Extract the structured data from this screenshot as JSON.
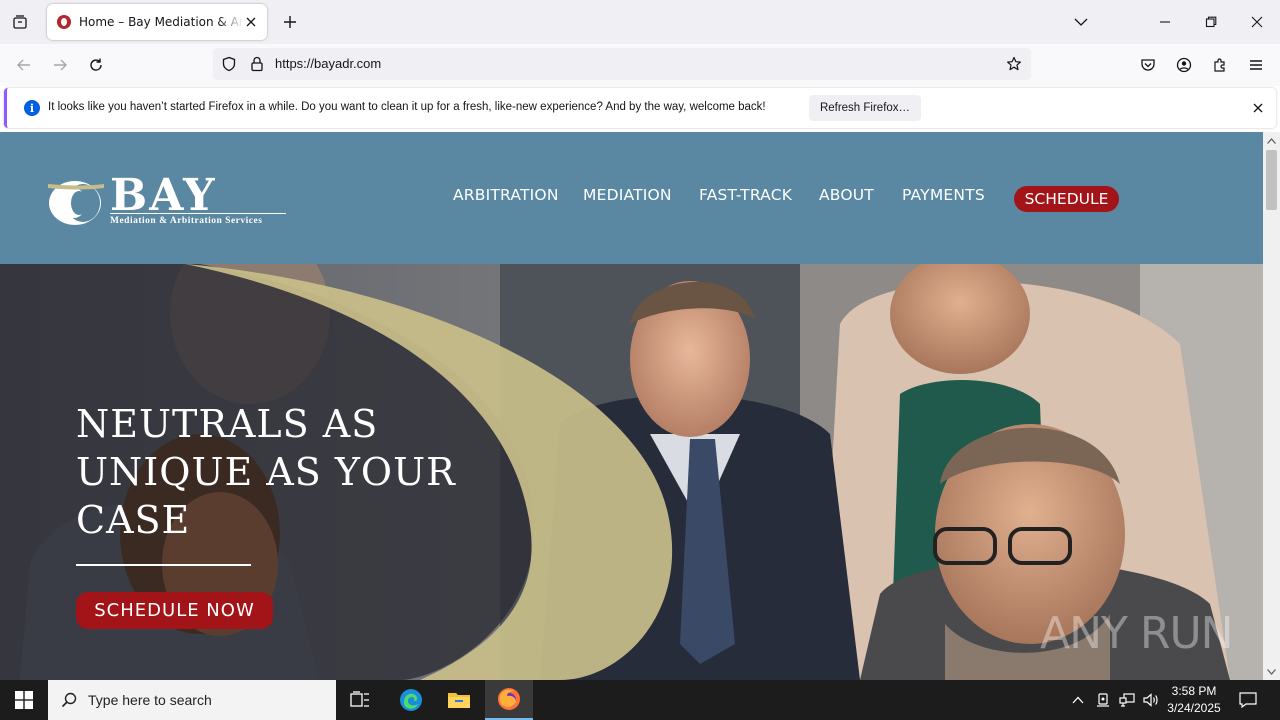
{
  "browser": {
    "tab_title": "Home – Bay Mediation & Arbitration Services",
    "url": "https://bayadr.com",
    "notification": {
      "message": "It looks like you haven’t started Firefox in a while. Do you want to clean it up for a fresh, like-new experience? And by the way, welcome back!",
      "button": "Refresh Firefox…"
    }
  },
  "site": {
    "logo": {
      "word": "BAY",
      "subtitle": "Mediation & Arbitration Services"
    },
    "nav": [
      "ARBITRATION",
      "MEDIATION",
      "FAST-TRACK",
      "ABOUT",
      "PAYMENTS"
    ],
    "nav_cta": "SCHEDULE",
    "hero": {
      "title_lines": [
        "NEUTRALS AS",
        "UNIQUE AS YOUR",
        "CASE"
      ],
      "cta": "SCHEDULE NOW"
    },
    "colors": {
      "header": "#5a87a1",
      "accent_red": "#a31418",
      "gold": "#c8bd8a"
    }
  },
  "watermark": "ANY RUN",
  "taskbar": {
    "search_placeholder": "Type here to search",
    "time": "3:58 PM",
    "date": "3/24/2025"
  }
}
